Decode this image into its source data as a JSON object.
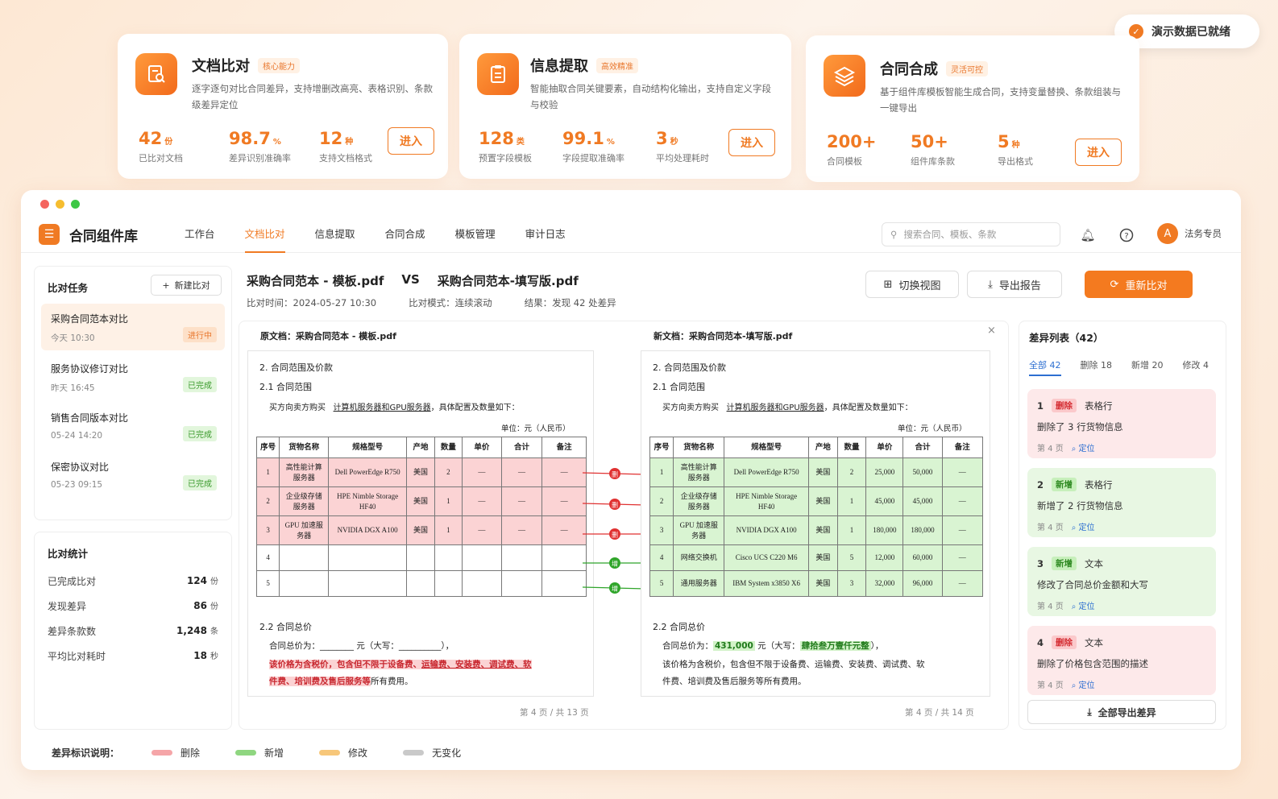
{
  "toast": {
    "text": "演示数据已就绪"
  },
  "cards": [
    {
      "title": "文档比对",
      "tag": "核心能力",
      "desc": "逐字逐句对比合同差异，支持增删改高亮、表格识别、条款级差异定位",
      "stats": [
        {
          "num": "42",
          "unit": "份",
          "label": "已比对文档"
        },
        {
          "num": "98.7",
          "unit": "%",
          "label": "差异识别准确率"
        },
        {
          "num": "12",
          "unit": "种",
          "label": "支持文档格式"
        }
      ],
      "button": "进入"
    },
    {
      "title": "信息提取",
      "tag": "高效精准",
      "desc": "智能抽取合同关键要素，自动结构化输出，支持自定义字段与校验",
      "stats": [
        {
          "num": "128",
          "unit": "类",
          "label": "预置字段模板"
        },
        {
          "num": "99.1",
          "unit": "%",
          "label": "字段提取准确率"
        },
        {
          "num": "3",
          "unit": "秒",
          "label": "平均处理耗时"
        }
      ],
      "button": "进入"
    },
    {
      "title": "合同合成",
      "tag": "灵活可控",
      "desc": "基于组件库模板智能生成合同，支持变量替换、条款组装与一键导出",
      "stats": [
        {
          "num": "200+",
          "unit": "",
          "label": "合同模板"
        },
        {
          "num": "50+",
          "unit": "",
          "label": "组件库条款"
        },
        {
          "num": "5",
          "unit": "种",
          "label": "导出格式"
        }
      ],
      "button": "进入"
    }
  ],
  "app": {
    "name": "合同组件库",
    "menu": [
      "工作台",
      "文档比对",
      "信息提取",
      "合同合成",
      "模板管理",
      "审计日志"
    ],
    "search_placeholder": "搜索合同、模板、条款",
    "user": "法务专员",
    "avatar": "A"
  },
  "tasks": {
    "title": "比对任务",
    "new_button": "新建比对",
    "items": [
      {
        "name": "采购合同范本对比",
        "time": "今天 10:30",
        "status": "进行中"
      },
      {
        "name": "服务协议修订对比",
        "time": "昨天 16:45",
        "status": "已完成"
      },
      {
        "name": "销售合同版本对比",
        "time": "05-24 14:20",
        "status": "已完成"
      },
      {
        "name": "保密协议对比",
        "time": "05-23 09:15",
        "status": "已完成"
      }
    ]
  },
  "stats": {
    "title": "比对统计",
    "rows": [
      {
        "label": "已完成比对",
        "value": "124",
        "unit": "份"
      },
      {
        "label": "发现差异",
        "value": "86",
        "unit": "份"
      },
      {
        "label": "差异条款数",
        "value": "1,248",
        "unit": "条"
      },
      {
        "label": "平均比对耗时",
        "value": "18",
        "unit": "秒"
      }
    ]
  },
  "compare": {
    "left_name": "采购合同范本 - 模板.pdf",
    "vs": "VS",
    "right_name": "采购合同范本-填写版.pdf",
    "time": "比对时间：2024-05-27 10:30",
    "mode": "比对模式：连续滚动",
    "result": "结果：发现 42 处差异",
    "btn_switch": "切换视图",
    "btn_export": "导出报告",
    "btn_recompare": "重新比对"
  },
  "docs": {
    "left_header": "原文档：采购合同范本 - 模板.pdf",
    "right_header": "新文档：采购合同范本-填写版.pdf",
    "section": "2. 合同范围及价款",
    "sub1": "2.1 合同范围",
    "para_prefix": "买方向卖方购买",
    "para_link": "计算机服务器和GPU服务器",
    "para_suffix": "，具体配置及数量如下：",
    "unit": "单位：元（人民币）",
    "cols": [
      "序号",
      "货物名称",
      "规格型号",
      "产地",
      "数量",
      "单价",
      "合计",
      "备注"
    ],
    "left_rows": [
      [
        "1",
        "高性能计算服务器",
        "Dell PowerEdge R750",
        "美国",
        "2",
        "—",
        "—",
        "—"
      ],
      [
        "2",
        "企业级存储服务器",
        "HPE Nimble Storage HF40",
        "美国",
        "1",
        "—",
        "—",
        "—"
      ],
      [
        "3",
        "GPU 加速服务器",
        "NVIDIA DGX A100",
        "美国",
        "1",
        "—",
        "—",
        "—"
      ],
      [
        "4",
        "",
        "",
        "",
        "",
        "",
        "",
        ""
      ],
      [
        "5",
        "",
        "",
        "",
        "",
        "",
        "",
        ""
      ]
    ],
    "right_rows": [
      [
        "1",
        "高性能计算服务器",
        "Dell PowerEdge R750",
        "美国",
        "2",
        "25,000",
        "50,000",
        "—"
      ],
      [
        "2",
        "企业级存储服务器",
        "HPE Nimble Storage HF40",
        "美国",
        "1",
        "45,000",
        "45,000",
        "—"
      ],
      [
        "3",
        "GPU 加速服务器",
        "NVIDIA DGX A100",
        "美国",
        "1",
        "180,000",
        "180,000",
        "—"
      ],
      [
        "4",
        "网络交换机",
        "Cisco UCS C220 M6",
        "美国",
        "5",
        "12,000",
        "60,000",
        "—"
      ],
      [
        "5",
        "通用服务器",
        "IBM System x3850 X6",
        "美国",
        "3",
        "32,000",
        "96,000",
        "—"
      ]
    ],
    "sub2": "2.2 合同总价",
    "left_total": "合同总价为：________ 元（大写：__________），",
    "left_note1": "该价格为含税价，包含但不限于设备费、",
    "left_note1b": "运输费、安装费、调试费、软",
    "left_note2": "件费、培训费及售后服务等",
    "left_note2b": "所有费用。",
    "right_total_a": "合同总价为：",
    "right_total_num": "431,000",
    "right_total_b": " 元（大写：",
    "right_total_cn": "肆拾叁万壹仟元整",
    "right_total_c": "），",
    "right_note1": "该价格为含税价，包含但不限于设备费、运输费、安装费、调试费、软",
    "right_note2": "件费、培训费及售后服务等所有费用。",
    "left_page": "第 4 页 / 共 13 页",
    "right_page": "第 4 页 / 共 14 页",
    "marker_del": "删",
    "marker_add": "增",
    "close": "×"
  },
  "difflist": {
    "title": "差异列表（42）",
    "tabs": [
      "全部 42",
      "删除 18",
      "新增 20",
      "修改 4"
    ],
    "items": [
      {
        "no": "1",
        "type": "删除",
        "kind": "表格行",
        "desc": "删除了 3 行货物信息",
        "page": "第 4 页",
        "loc": "定位"
      },
      {
        "no": "2",
        "type": "新增",
        "kind": "表格行",
        "desc": "新增了 2 行货物信息",
        "page": "第 4 页",
        "loc": "定位"
      },
      {
        "no": "3",
        "type": "新增",
        "kind": "文本",
        "desc": "修改了合同总价金额和大写",
        "page": "第 4 页",
        "loc": "定位"
      },
      {
        "no": "4",
        "type": "删除",
        "kind": "文本",
        "desc": "删除了价格包含范围的描述",
        "page": "第 4 页",
        "loc": "定位"
      }
    ],
    "export_all": "全部导出差异"
  },
  "legend": {
    "title": "差异标识说明：",
    "items": [
      "删除",
      "新增",
      "修改",
      "无变化"
    ]
  },
  "colors": {
    "accent": "#f07a23",
    "del": "#f5a5a8",
    "add": "#8fd680",
    "mod": "#f7c77a",
    "none": "#c9c9c9"
  }
}
